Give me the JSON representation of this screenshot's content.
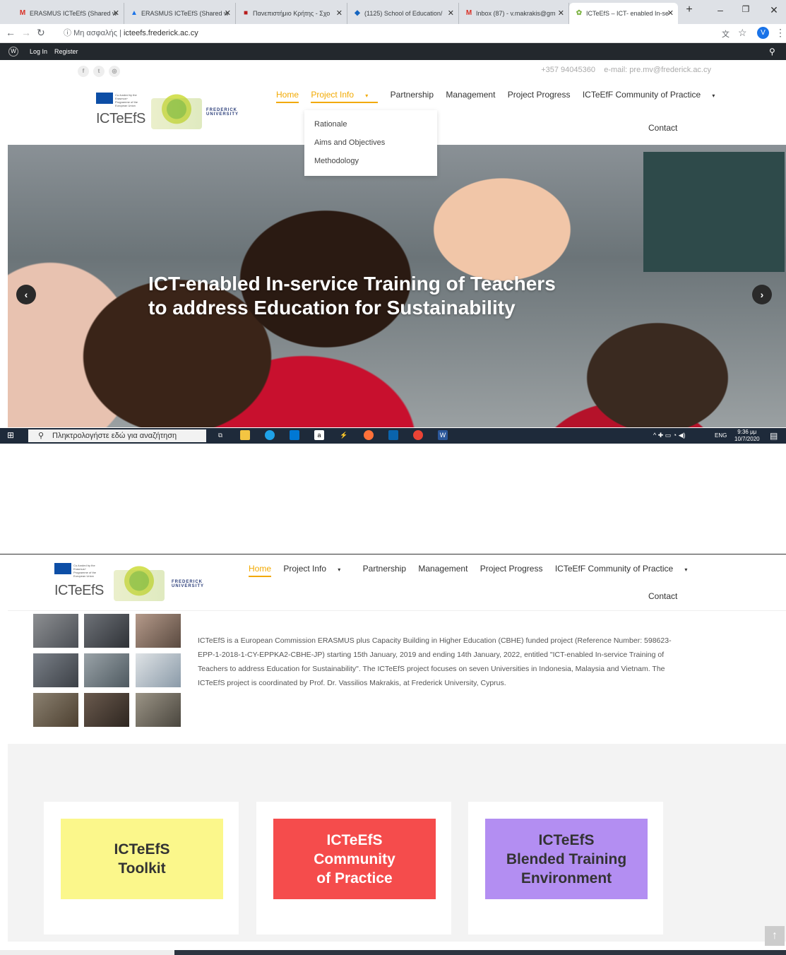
{
  "browser": {
    "tabs": [
      {
        "icon": "M",
        "title": "ERASMUS ICTeEfS (Shared w"
      },
      {
        "icon": "▲",
        "title": "ERASMUS ICTeEfS (Shared w"
      },
      {
        "icon": "■",
        "title": "Πανεπιστήμιο Κρήτης - Σχο"
      },
      {
        "icon": "◆",
        "title": "(1125) School of Education/"
      },
      {
        "icon": "M",
        "title": "Inbox (87) - v.makrakis@gm"
      },
      {
        "icon": "✿",
        "title": "ICTeEfS – ICT- enabled In-se"
      }
    ],
    "new_tab": "+",
    "security_label": "Μη ασφαλής",
    "url": "icteefs.frederick.ac.cy",
    "profile_initial": "V"
  },
  "wp_admin": {
    "login": "Log In",
    "register": "Register"
  },
  "topbar": {
    "social": [
      "f",
      "t",
      "◎"
    ],
    "phone": "+357 94045360",
    "email": "e-mail: pre.mv@frederick.ac.cy"
  },
  "logo": {
    "eu_text": "Co-funded by the Erasmus+ Programme of the European Union",
    "name": "ICTeEfS",
    "frederick": "FREDERICK UNIVERSITY"
  },
  "menu": {
    "items": [
      "Home",
      "Project Info",
      "Partnership",
      "Management",
      "Project Progress",
      "ICTeEfF Community of Practice"
    ],
    "contact": "Contact"
  },
  "dropdown": [
    "Rationale",
    "Aims and Objectives",
    "Methodology"
  ],
  "hero": {
    "line1": "ICT-enabled In-service Training of Teachers",
    "line2": "to address Education for Sustainability"
  },
  "taskbar": {
    "search": "Πληκτρολογήστε εδώ για αναζήτηση",
    "lang": "ENG",
    "time": "9:36 μμ",
    "date": "10/7/2020"
  },
  "intro": {
    "text": "ICTeEfS is a European Commission ERASMUS plus Capacity Building in Higher Education (CBHE) funded project (Reference Number: 598623-EPP-1-2018-1-CY-EPPKA2-CBHE-JP) starting 15th January, 2019 and ending 14th January, 2022, entitled \"ICT-enabled In-service Training of Teachers to address Education for Sustainability\". The ICTeEfS project focuses on seven Universities in Indonesia, Malaysia and Vietnam. The ICTeEfS project is coordinated by Prof. Dr. Vassilios Makrakis, at Frederick University, Cyprus."
  },
  "cards": [
    {
      "label": "ICTeEfS\nToolkit",
      "bg": "#fbf78b",
      "color": "#333333"
    },
    {
      "label": "ICTeEfS\nCommunity\nof Practice",
      "bg": "#f54c4c",
      "color": "#ffffff"
    },
    {
      "label": "ICTeEfS\nBlended Training\nEnvironment",
      "bg": "#b38ef2",
      "color": "#333333"
    }
  ],
  "colors": {
    "accent": "#f2a900",
    "wpbar": "#23282d"
  }
}
